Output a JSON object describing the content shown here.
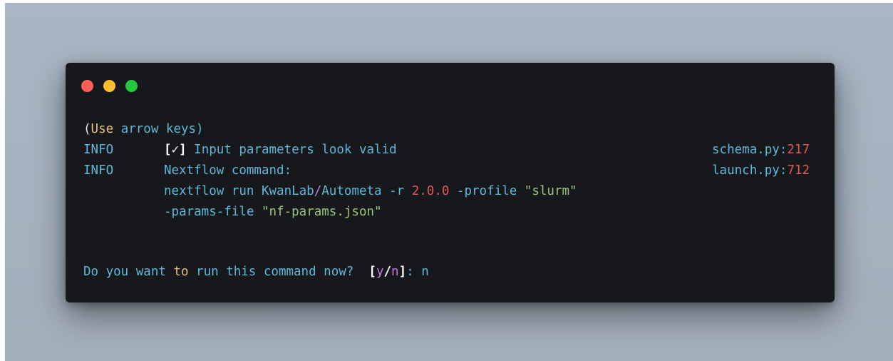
{
  "window": {
    "traffic_lights": [
      "close",
      "minimize",
      "zoom"
    ]
  },
  "terminal": {
    "hint": {
      "open": "(",
      "use": "Use",
      "rest": " arrow keys)"
    },
    "log1": {
      "level": "INFO",
      "bracket_open": "[",
      "check": "✓",
      "bracket_close": "]",
      "message": " Input parameters look valid",
      "source_file": "schema.py",
      "source_sep": ":",
      "source_line": "217"
    },
    "log2": {
      "level": "INFO",
      "message": "Nextflow command:",
      "source_file": "launch.py",
      "source_sep": ":",
      "source_line": "712"
    },
    "command": {
      "part1": "nextflow run KwanLab",
      "slash": "/",
      "part2": "Autometa ",
      "flag_r": "-r",
      "space1": " ",
      "version": "2.0.0",
      "space2": " ",
      "flag_profile": "-profile",
      "space3": " ",
      "profile_value": "\"slurm\"",
      "flag_params": "-params-file",
      "space4": " ",
      "params_value": "\"nf-params.json\""
    },
    "prompt": {
      "part1": "Do you want ",
      "to": "to",
      "part2": " run this command now?  ",
      "bracket_open": "[",
      "y": "y",
      "slash": "/",
      "n": "n",
      "bracket_close": "]",
      "colon": ": ",
      "answer": "n"
    }
  },
  "colors": {
    "background": "#a9b5c3",
    "terminal_bg": "#16181c",
    "cyan": "#5fb7d9",
    "yellow": "#e5c07b",
    "red": "#e0575a",
    "green": "#98c379",
    "magenta": "#c678dd"
  }
}
